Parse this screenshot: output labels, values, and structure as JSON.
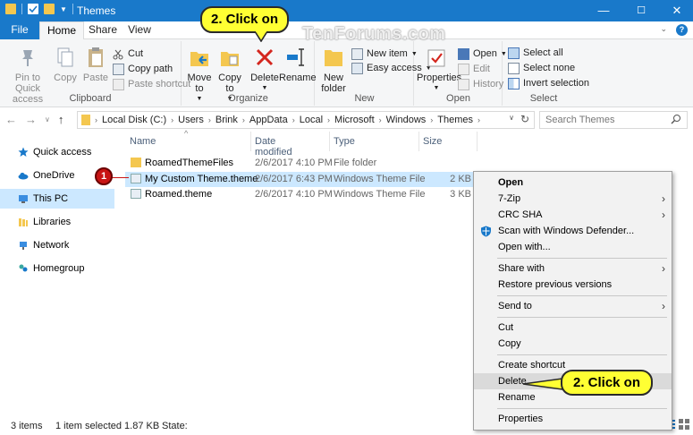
{
  "window": {
    "title": "Themes",
    "controls": {
      "minimize": "—",
      "maximize": "☐",
      "close": "✕"
    }
  },
  "tabs": [
    {
      "label": "File"
    },
    {
      "label": "Home"
    },
    {
      "label": "Share"
    },
    {
      "label": "View"
    }
  ],
  "ribbon": {
    "clipboard": {
      "group_label": "Clipboard",
      "pin": "Pin to Quick\naccess",
      "copy": "Copy",
      "paste": "Paste",
      "cut": "Cut",
      "copy_path": "Copy path",
      "paste_shortcut": "Paste shortcut"
    },
    "organize": {
      "group_label": "Organize",
      "move_to": "Move\nto",
      "copy_to": "Copy\nto",
      "delete": "Delete",
      "rename": "Rename"
    },
    "new": {
      "group_label": "New",
      "new_folder": "New\nfolder",
      "new_item": "New item",
      "easy_access": "Easy access"
    },
    "open": {
      "group_label": "Open",
      "properties": "Properties",
      "open": "Open",
      "edit": "Edit",
      "history": "History"
    },
    "select": {
      "group_label": "Select",
      "select_all": "Select all",
      "select_none": "Select none",
      "invert_selection": "Invert selection"
    }
  },
  "address": {
    "crumbs": [
      "Local Disk (C:)",
      "Users",
      "Brink",
      "AppData",
      "Local",
      "Microsoft",
      "Windows",
      "Themes"
    ],
    "search_placeholder": "Search Themes"
  },
  "nav": [
    {
      "label": "Quick access"
    },
    {
      "label": "OneDrive"
    },
    {
      "label": "This PC"
    },
    {
      "label": "Libraries"
    },
    {
      "label": "Network"
    },
    {
      "label": "Homegroup"
    }
  ],
  "columns": {
    "name": "Name",
    "date": "Date modified",
    "type": "Type",
    "size": "Size"
  },
  "files": [
    {
      "name": "RoamedThemeFiles",
      "date": "2/6/2017 4:10 PM",
      "type": "File folder",
      "size": ""
    },
    {
      "name": "My Custom Theme.theme",
      "date": "2/6/2017 6:43 PM",
      "type": "Windows Theme File",
      "size": "2 KB"
    },
    {
      "name": "Roamed.theme",
      "date": "2/6/2017 4:10 PM",
      "type": "Windows Theme File",
      "size": "3 KB"
    }
  ],
  "context_menu": [
    "Open",
    "7-Zip",
    "CRC SHA",
    "Scan with Windows Defender...",
    "Open with...",
    "Share with",
    "Restore previous versions",
    "Send to",
    "Cut",
    "Copy",
    "Create shortcut",
    "Delete",
    "Rename",
    "Properties"
  ],
  "status": {
    "items": "3 items",
    "selected": "1 item selected  1.87 KB",
    "state": "State:"
  },
  "annotations": {
    "callout_ribbon": "2. Click on",
    "callout_menu": "2. Click on",
    "step1_badge": "1",
    "watermark": "TenForums.com"
  },
  "colors": {
    "accent": "#1979ca",
    "selection": "#cce8ff",
    "callout": "#ffff33",
    "badge": "#c81414"
  }
}
